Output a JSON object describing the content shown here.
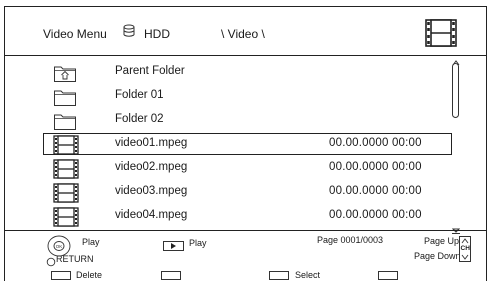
{
  "header": {
    "title": "Video Menu",
    "drive": "HDD",
    "path": "\\ Video \\"
  },
  "icons": {
    "drive": "hdd-icon",
    "header_media": "film-icon",
    "folder_up": "parent-folder-icon",
    "folder": "folder-icon",
    "video": "film-icon"
  },
  "files": [
    {
      "type": "parent",
      "name": "Parent Folder",
      "date": ""
    },
    {
      "type": "folder",
      "name": "Folder 01",
      "date": ""
    },
    {
      "type": "folder",
      "name": "Folder 02",
      "date": ""
    },
    {
      "type": "video",
      "name": "video01.mpeg",
      "date": "00.00.0000 00:00",
      "selected": true
    },
    {
      "type": "video",
      "name": "video02.mpeg",
      "date": "00.00.0000 00:00"
    },
    {
      "type": "video",
      "name": "video03.mpeg",
      "date": "00.00.0000 00:00"
    },
    {
      "type": "video",
      "name": "video04.mpeg",
      "date": "00.00.0000 00:00"
    }
  ],
  "footer": {
    "dpad_play": "Play",
    "return_label": "RETURN",
    "play_button": "Play",
    "page_info": "Page 0001/0003",
    "page_up": "Page Up",
    "page_down": "Page Down",
    "ch_label": "CH",
    "color_buttons": [
      {
        "label": "Delete"
      },
      {
        "label": ""
      },
      {
        "label": "Select"
      },
      {
        "label": ""
      }
    ]
  }
}
